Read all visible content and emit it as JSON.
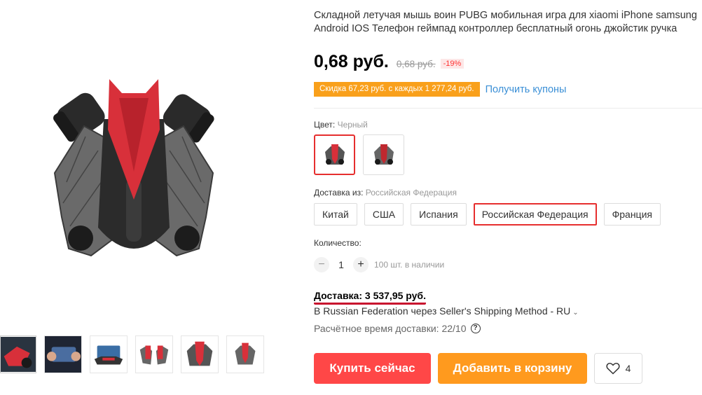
{
  "product": {
    "title_line1": "Складной летучая мышь воин PUBG мобильная игра для xiaomi iPhone samsung",
    "title_line2": "Android IOS Телефон геймпад контроллер бесплатный огонь джойстик ручка"
  },
  "price": {
    "current": "0,68 руб.",
    "old": "0,68 руб.",
    "discount": "-19%"
  },
  "promo": {
    "badge": "Скидка 67,23 руб. с каждых 1 277,24 руб.",
    "coupon_link": "Получить купоны"
  },
  "color": {
    "label": "Цвет:",
    "selected": "Черный"
  },
  "shipping_from": {
    "label": "Доставка из:",
    "selected": "Российская Федерация",
    "options": [
      "Китай",
      "США",
      "Испания",
      "Российская Федерация",
      "Франция"
    ]
  },
  "quantity": {
    "label": "Количество:",
    "minus": "−",
    "value": "1",
    "plus": "+",
    "stock": "100 шт. в наличии"
  },
  "delivery": {
    "cost": "Доставка: 3 537,95 руб.",
    "method": "В Russian Federation через Seller's Shipping Method - RU",
    "method_chevron": "⌄",
    "time": "Расчётное время доставки: 22/10",
    "help": "?"
  },
  "actions": {
    "buy_now": "Купить сейчас",
    "add_to_cart": "Добавить в корзину",
    "wishlist_count": "4"
  },
  "colors": {
    "accent_red": "#ff4747",
    "accent_orange": "#ff9a1e",
    "link_blue": "#3a8fd6",
    "selected_border": "#e62e2e"
  }
}
